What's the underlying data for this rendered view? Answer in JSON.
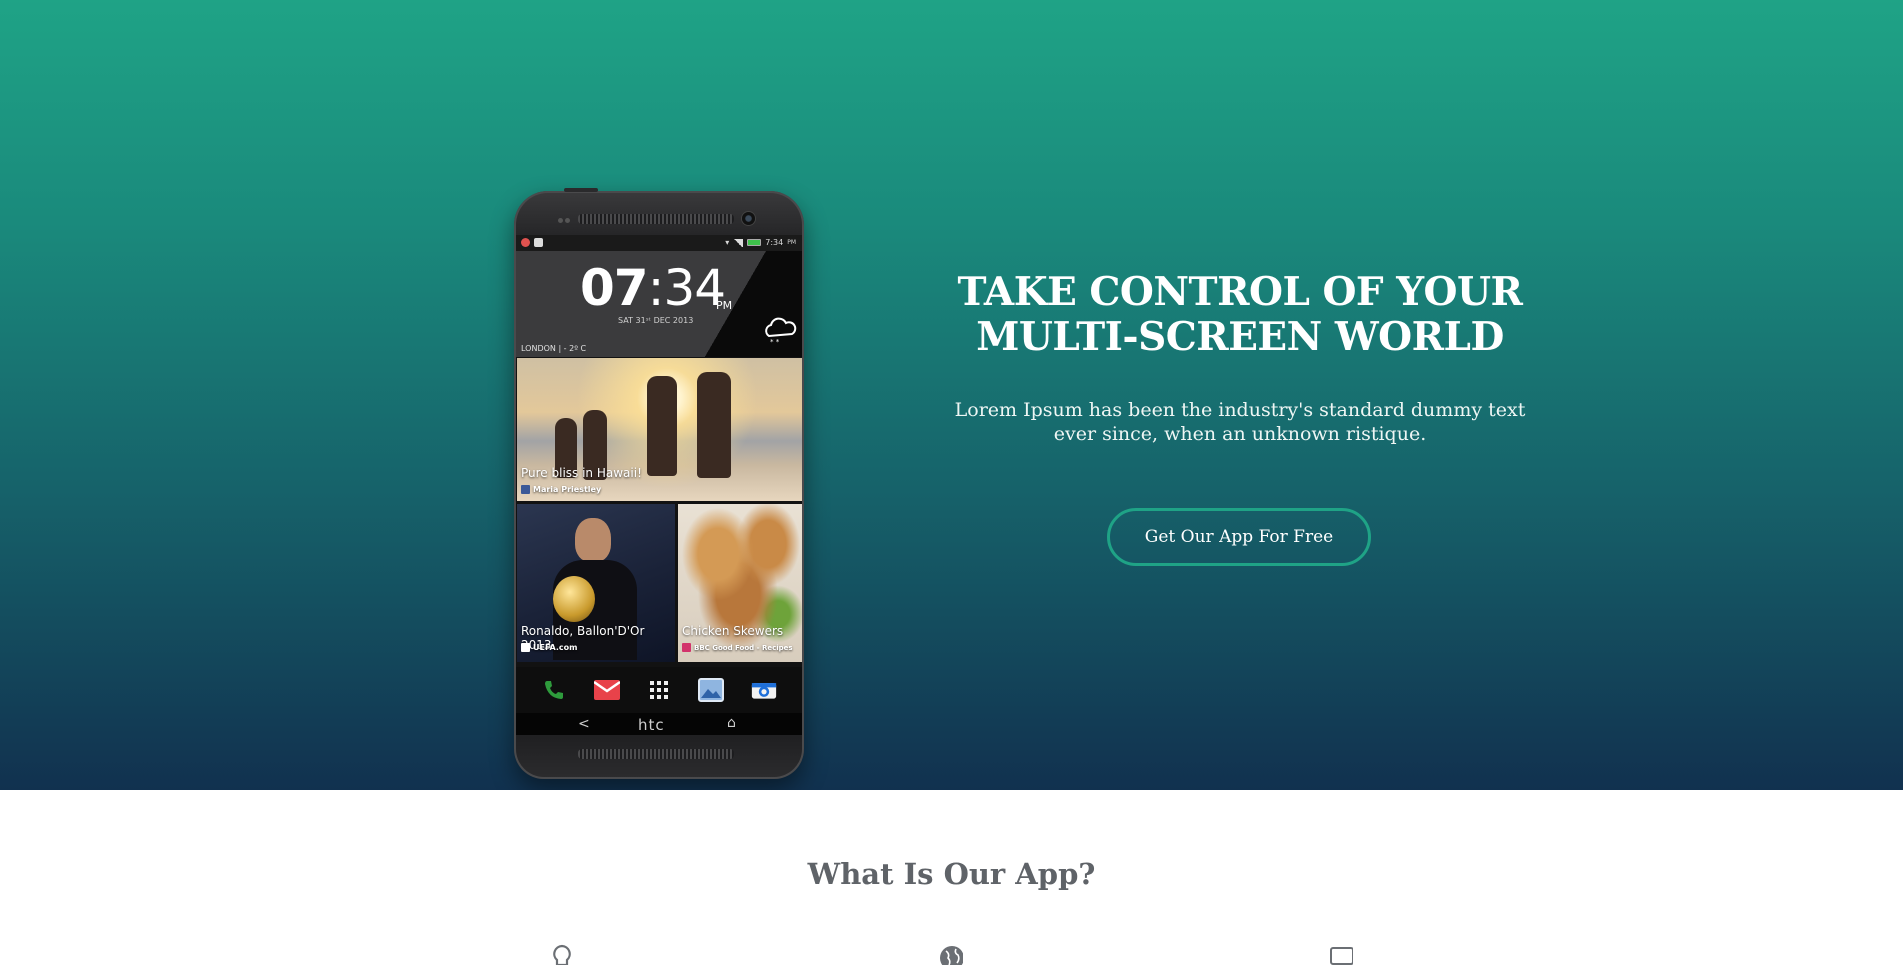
{
  "hero": {
    "title_line1": "TAKE CONTROL OF YOUR",
    "title_line2": "MULTI-SCREEN WORLD",
    "subtitle_line1": "Lorem Ipsum has been the industry's standard dummy text",
    "subtitle_line2": "ever since, when an unknown ristique.",
    "cta_label": "Get Our App For Free",
    "gradient_top": "#1fa386",
    "gradient_bottom": "#11314f",
    "accent": "#1fa386"
  },
  "phone": {
    "status_time": "7:34",
    "status_ampm": "PM",
    "clock_hours": "07",
    "clock_minutes": "34",
    "clock_ampm": "PM",
    "clock_date": "SAT 31ˢᵗ DEC 2013",
    "location": "LONDON | - 2º C",
    "weather_icon": "cloud-snow-icon",
    "tiles": [
      {
        "caption": "Pure bliss in Hawaii!",
        "source": "Maria Priestley",
        "source_icon": "facebook-icon"
      },
      {
        "caption": "Ronaldo, Ballon'D'Or 2013",
        "source": "UEFA.com",
        "source_icon": "uefa-icon"
      },
      {
        "caption": "Chicken Skewers",
        "source": "BBC Good Food - Recipes",
        "source_icon": "bbc-good-food-icon"
      }
    ],
    "dock_icons": [
      "phone-icon",
      "mail-icon",
      "apps-grid-icon",
      "gallery-icon",
      "camera-icon"
    ],
    "nav": {
      "back": "<",
      "brand": "htc",
      "home": "⌂"
    }
  },
  "section": {
    "title": "What Is Our App?",
    "feature_icons": [
      "lightbulb-icon",
      "globe-icon",
      "desktop-icon"
    ]
  }
}
